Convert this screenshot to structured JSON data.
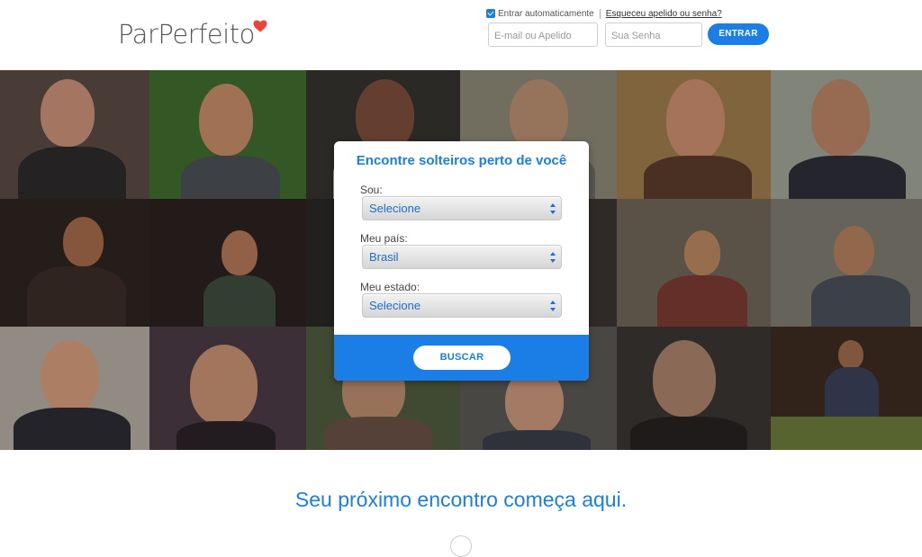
{
  "header": {
    "logo_text": "ParPerfeito",
    "remember_label": "Entrar automaticamente",
    "forgot_link": "Esqueceu apelido ou senha?",
    "email_placeholder": "E-mail ou Apelido",
    "password_placeholder": "Sua Senha",
    "enter_button": "ENTRAR"
  },
  "search": {
    "title": "Encontre solteiros perto de você",
    "i_am_label": "Sou:",
    "i_am_value": "Selecione",
    "country_label": "Meu país:",
    "country_value": "Brasil",
    "state_label": "Meu estado:",
    "state_value": "Selecione",
    "search_button": "BUSCAR"
  },
  "tagline": "Seu próximo encontro começa aqui.",
  "colors": {
    "accent": "#1a7ee6",
    "logo_heart": "#e8453c",
    "logo_text": "#555555"
  }
}
